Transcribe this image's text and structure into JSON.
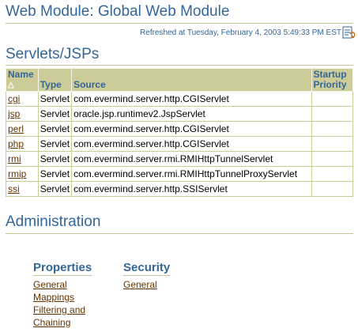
{
  "header": {
    "title": "Web Module: Global Web Module",
    "refreshed": "Refreshed at Tuesday, February 4, 2003 5:49:33 PM EST"
  },
  "servlets": {
    "title": "Servlets/JSPs",
    "columns": {
      "name": "Name",
      "sort_indicator": "△",
      "type": "Type",
      "source": "Source",
      "startup_priority": [
        "Startup",
        "Priority"
      ]
    },
    "rows": [
      {
        "name": "cgi",
        "type": "Servlet",
        "source": "com.evermind.server.http.CGIServlet",
        "priority": ""
      },
      {
        "name": "jsp",
        "type": "Servlet",
        "source": "oracle.jsp.runtimev2.JspServlet",
        "priority": ""
      },
      {
        "name": "perl",
        "type": "Servlet",
        "source": "com.evermind.server.http.CGIServlet",
        "priority": ""
      },
      {
        "name": "php",
        "type": "Servlet",
        "source": "com.evermind.server.http.CGIServlet",
        "priority": ""
      },
      {
        "name": "rmi",
        "type": "Servlet",
        "source": "com.evermind.server.rmi.RMIHttpTunnelServlet",
        "priority": ""
      },
      {
        "name": "rmip",
        "type": "Servlet",
        "source": "com.evermind.server.rmi.RMIHttpTunnelProxyServlet",
        "priority": ""
      },
      {
        "name": "ssi",
        "type": "Servlet",
        "source": "com.evermind.server.http.SSIServlet",
        "priority": ""
      }
    ]
  },
  "administration": {
    "title": "Administration",
    "properties": {
      "title": "Properties",
      "links": [
        "General",
        "Mappings",
        "Filtering and",
        "Chaining"
      ]
    },
    "security": {
      "title": "Security",
      "links": [
        "General"
      ]
    }
  },
  "icons": {
    "refresh": "refresh-page-icon",
    "sort": "sort-ascending-icon"
  },
  "colors": {
    "heading": "#336699",
    "link": "#663300",
    "table_header": "#cccc99",
    "rule": "#c9c397"
  }
}
